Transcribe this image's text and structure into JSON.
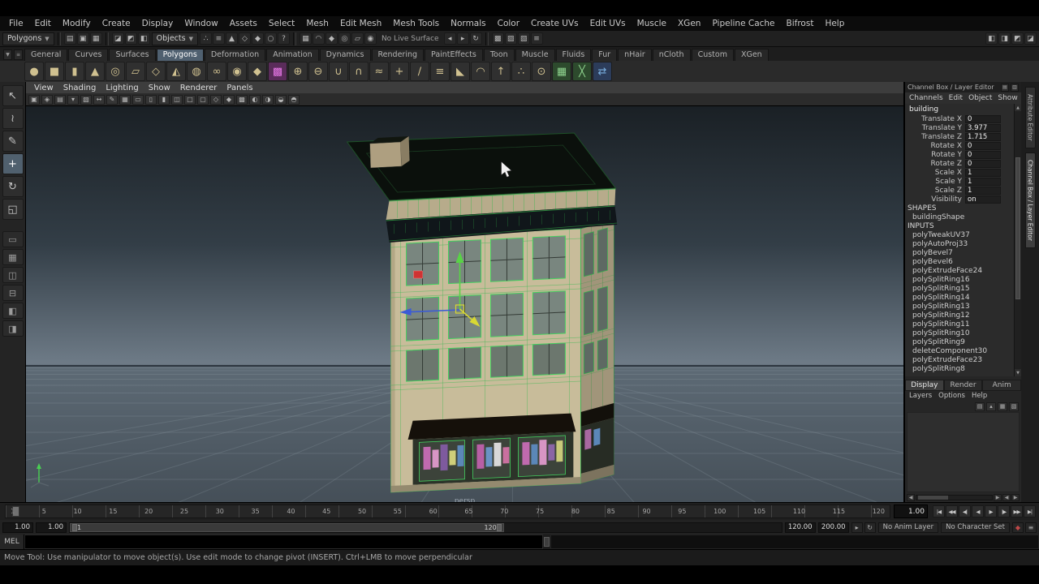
{
  "menu_bar": [
    "File",
    "Edit",
    "Modify",
    "Create",
    "Display",
    "Window",
    "Assets",
    "Select",
    "Mesh",
    "Edit Mesh",
    "Mesh Tools",
    "Normals",
    "Color",
    "Create UVs",
    "Edit UVs",
    "Muscle",
    "XGen",
    "Pipeline Cache",
    "Bifrost",
    "Help"
  ],
  "status_line": {
    "mode_menu": "Polygons",
    "objects_menu": "Objects",
    "no_live_surface": "No Live Surface",
    "file_icons": [
      {
        "name": "new-scene-icon",
        "glyph": "▤"
      },
      {
        "name": "open-scene-icon",
        "glyph": "▣"
      },
      {
        "name": "save-scene-icon",
        "glyph": "▦"
      }
    ],
    "selection_icons": [
      {
        "name": "select-hierarchy-icon",
        "glyph": "◪"
      },
      {
        "name": "select-object-icon",
        "glyph": "◩"
      },
      {
        "name": "select-component-icon",
        "glyph": "◧"
      }
    ],
    "mask_icons": [
      {
        "name": "mask-points-icon",
        "glyph": "∴"
      },
      {
        "name": "mask-lines-icon",
        "glyph": "≡"
      },
      {
        "name": "mask-faces-icon",
        "glyph": "▲"
      },
      {
        "name": "mask-hulls-icon",
        "glyph": "◇"
      },
      {
        "name": "mask-pivots-icon",
        "glyph": "◆"
      },
      {
        "name": "mask-handles-icon",
        "glyph": "○"
      },
      {
        "name": "mask-misc-icon",
        "glyph": "?"
      }
    ],
    "snap_icons": [
      {
        "name": "snap-grid-icon",
        "glyph": "▦"
      },
      {
        "name": "snap-curve-icon",
        "glyph": "◠"
      },
      {
        "name": "snap-point-icon",
        "glyph": "◆"
      },
      {
        "name": "snap-projected-center-icon",
        "glyph": "◎"
      },
      {
        "name": "snap-view-plane-icon",
        "glyph": "▱"
      },
      {
        "name": "make-live-icon",
        "glyph": "◉"
      }
    ],
    "history_icons": [
      {
        "name": "input-connections-icon",
        "glyph": "◂"
      },
      {
        "name": "output-connections-icon",
        "glyph": "▸"
      },
      {
        "name": "construction-history-icon",
        "glyph": "↻"
      }
    ],
    "render_icons": [
      {
        "name": "open-render-view-icon",
        "glyph": "▩"
      },
      {
        "name": "render-current-frame-icon",
        "glyph": "▨"
      },
      {
        "name": "ipr-render-icon",
        "glyph": "▧"
      },
      {
        "name": "render-settings-icon",
        "glyph": "≡"
      }
    ],
    "right_icons": [
      {
        "name": "toggle-modeling-toolkit-icon",
        "glyph": "◧"
      },
      {
        "name": "toggle-attribute-editor-icon",
        "glyph": "◨"
      },
      {
        "name": "toggle-tool-settings-icon",
        "glyph": "◩"
      },
      {
        "name": "toggle-channel-box-icon",
        "glyph": "◪"
      }
    ]
  },
  "shelf": {
    "tabs": [
      {
        "label": "General"
      },
      {
        "label": "Curves"
      },
      {
        "label": "Surfaces"
      },
      {
        "label": "Polygons",
        "active": true
      },
      {
        "label": "Deformation"
      },
      {
        "label": "Animation"
      },
      {
        "label": "Dynamics"
      },
      {
        "label": "Rendering"
      },
      {
        "label": "PaintEffects"
      },
      {
        "label": "Toon"
      },
      {
        "label": "Muscle"
      },
      {
        "label": "Fluids"
      },
      {
        "label": "Fur"
      },
      {
        "label": "nHair"
      },
      {
        "label": "nCloth"
      },
      {
        "label": "Custom"
      },
      {
        "label": "XGen"
      }
    ],
    "icons": [
      {
        "name": "polygon-sphere-icon",
        "glyph": "●"
      },
      {
        "name": "polygon-cube-icon",
        "glyph": "■"
      },
      {
        "name": "polygon-cylinder-icon",
        "glyph": "▮"
      },
      {
        "name": "polygon-cone-icon",
        "glyph": "▲"
      },
      {
        "name": "polygon-torus-icon",
        "glyph": "◎"
      },
      {
        "name": "polygon-plane-icon",
        "glyph": "▱"
      },
      {
        "name": "polygon-prism-icon",
        "glyph": "◇"
      },
      {
        "name": "polygon-pyramid-icon",
        "glyph": "◭"
      },
      {
        "name": "polygon-pipe-icon",
        "glyph": "◍"
      },
      {
        "name": "polygon-helix-icon",
        "glyph": "∞"
      },
      {
        "name": "polygon-soccer-ball-icon",
        "glyph": "◉"
      },
      {
        "name": "polygon-platonic-icon",
        "glyph": "◆"
      },
      {
        "name": "uv-editor-icon",
        "glyph": "▩",
        "color": "#e878e8",
        "bg": "#5a2c5a"
      },
      {
        "name": "combine-icon",
        "glyph": "⊕"
      },
      {
        "name": "separate-icon",
        "glyph": "⊖"
      },
      {
        "name": "boolean-union-icon",
        "glyph": "∪"
      },
      {
        "name": "boolean-intersect-icon",
        "glyph": "∩"
      },
      {
        "name": "smooth-icon",
        "glyph": "≈"
      },
      {
        "name": "append-to-polygon-icon",
        "glyph": "+"
      },
      {
        "name": "split-polygon-icon",
        "glyph": "∕"
      },
      {
        "name": "insert-edge-loop-icon",
        "glyph": "≡"
      },
      {
        "name": "bevel-icon",
        "glyph": "◣"
      },
      {
        "name": "bridge-icon",
        "glyph": "◠"
      },
      {
        "name": "extrude-icon",
        "glyph": "↑"
      },
      {
        "name": "merge-vertices-icon",
        "glyph": "∴"
      },
      {
        "name": "target-weld-icon",
        "glyph": "⊙"
      },
      {
        "name": "quad-draw-icon",
        "glyph": "▦",
        "color": "#8fd48f",
        "bg": "#2d4a2d"
      },
      {
        "name": "multi-cut-icon",
        "glyph": "╳",
        "color": "#8fd48f",
        "bg": "#2d4a2d"
      },
      {
        "name": "symmetry-icon",
        "glyph": "⇄",
        "color": "#7ab0e0",
        "bg": "#2c3c5a"
      }
    ]
  },
  "toolbox": {
    "tools": [
      {
        "name": "select-tool-icon",
        "glyph": "↖"
      },
      {
        "name": "lasso-tool-icon",
        "glyph": "≀"
      },
      {
        "name": "paint-select-tool-icon",
        "glyph": "✎"
      },
      {
        "name": "move-tool-icon",
        "glyph": "+",
        "active": true
      },
      {
        "name": "rotate-tool-icon",
        "glyph": "↻"
      },
      {
        "name": "scale-tool-icon",
        "glyph": "◱"
      }
    ],
    "layouts": [
      {
        "name": "layout-single-pane-icon",
        "glyph": "▭"
      },
      {
        "name": "layout-four-pane-icon",
        "glyph": "▦"
      },
      {
        "name": "layout-two-pane-side-icon",
        "glyph": "◫"
      },
      {
        "name": "layout-two-pane-stacked-icon",
        "glyph": "⊟"
      },
      {
        "name": "layout-outliner-persp-icon",
        "glyph": "◧"
      },
      {
        "name": "layout-persp-graph-icon",
        "glyph": "◨"
      }
    ]
  },
  "viewport": {
    "menus": [
      "View",
      "Shading",
      "Lighting",
      "Show",
      "Renderer",
      "Panels"
    ],
    "toolbar_icons": [
      {
        "name": "camera-select-icon",
        "glyph": "▣"
      },
      {
        "name": "camera-lock-icon",
        "glyph": "◈"
      },
      {
        "name": "camera-attributes-icon",
        "glyph": "▤"
      },
      {
        "name": "bookmarks-icon",
        "glyph": "▾"
      },
      {
        "name": "image-plane-icon",
        "glyph": "▧"
      },
      {
        "name": "2d-pan-zoom-icon",
        "glyph": "↔"
      },
      {
        "name": "grease-pencil-icon",
        "glyph": "✎"
      },
      {
        "name": "grid-toggle-icon",
        "glyph": "▦"
      },
      {
        "name": "film-gate-icon",
        "glyph": "▭"
      },
      {
        "name": "resolution-gate-icon",
        "glyph": "▯"
      },
      {
        "name": "gate-mask-icon",
        "glyph": "▮"
      },
      {
        "name": "field-chart-icon",
        "glyph": "◫"
      },
      {
        "name": "safe-action-icon",
        "glyph": "□"
      },
      {
        "name": "safe-title-icon",
        "glyph": "▢"
      },
      {
        "name": "wireframe-mode-icon",
        "glyph": "◇"
      },
      {
        "name": "shaded-mode-icon",
        "glyph": "◆"
      },
      {
        "name": "textured-mode-icon",
        "glyph": "▩"
      },
      {
        "name": "lighting-toggle-icon",
        "glyph": "◐"
      },
      {
        "name": "shadows-toggle-icon",
        "glyph": "◑"
      },
      {
        "name": "xray-toggle-icon",
        "glyph": "◒"
      },
      {
        "name": "isolate-select-icon",
        "glyph": "◓"
      }
    ],
    "camera_label": "persp"
  },
  "channel_box": {
    "title": "Channel Box / Layer Editor",
    "title_icons": [
      {
        "name": "channel-box-menu-icon",
        "glyph": "▤"
      },
      {
        "name": "layer-editor-menu-icon",
        "glyph": "▥"
      }
    ],
    "menus": [
      "Channels",
      "Edit",
      "Object",
      "Show"
    ],
    "object_name": "building",
    "channels": [
      {
        "name": "Translate X",
        "value": "0"
      },
      {
        "name": "Translate Y",
        "value": "3.977"
      },
      {
        "name": "Translate Z",
        "value": "1.715"
      },
      {
        "name": "Rotate X",
        "value": "0"
      },
      {
        "name": "Rotate Y",
        "value": "0"
      },
      {
        "name": "Rotate Z",
        "value": "0"
      },
      {
        "name": "Scale X",
        "value": "1"
      },
      {
        "name": "Scale Y",
        "value": "1"
      },
      {
        "name": "Scale Z",
        "value": "1"
      },
      {
        "name": "Visibility",
        "value": "on"
      }
    ],
    "shapes_header": "SHAPES",
    "shapes": [
      "buildingShape"
    ],
    "inputs_header": "INPUTS",
    "inputs": [
      "polyTweakUV37",
      "polyAutoProj33",
      "polyBevel7",
      "polyBevel6",
      "polyExtrudeFace24",
      "polySplitRing16",
      "polySplitRing15",
      "polySplitRing14",
      "polySplitRing13",
      "polySplitRing12",
      "polySplitRing11",
      "polySplitRing10",
      "polySplitRing9",
      "deleteComponent30",
      "polyExtrudeFace23",
      "polySplitRing8"
    ]
  },
  "layer_editor": {
    "tabs": [
      {
        "label": "Display",
        "active": true
      },
      {
        "label": "Render"
      },
      {
        "label": "Anim"
      }
    ],
    "menus": [
      "Layers",
      "Options",
      "Help"
    ],
    "icons": [
      {
        "name": "layer-options-icon",
        "glyph": "▤"
      },
      {
        "name": "move-layer-up-icon",
        "glyph": "▴"
      },
      {
        "name": "create-empty-layer-icon",
        "glyph": "▦"
      },
      {
        "name": "create-layer-from-selected-icon",
        "glyph": "▧"
      }
    ]
  },
  "side_tabs": [
    {
      "label": "Attribute Editor"
    },
    {
      "label": "Channel Box / Layer Editor",
      "active": true
    }
  ],
  "time_slider": {
    "ticks": [
      "1",
      "5",
      "10",
      "15",
      "20",
      "25",
      "30",
      "35",
      "40",
      "45",
      "50",
      "55",
      "60",
      "65",
      "70",
      "75",
      "80",
      "85",
      "90",
      "95",
      "100",
      "105",
      "110",
      "115",
      "120"
    ],
    "current_time": "1.00",
    "playback_buttons": [
      {
        "name": "go-to-start-button",
        "glyph": "|◀"
      },
      {
        "name": "step-back-frame-button",
        "glyph": "◀◀"
      },
      {
        "name": "step-back-key-button",
        "glyph": "◀|"
      },
      {
        "name": "play-backwards-button",
        "glyph": "◀"
      },
      {
        "name": "play-forwards-button",
        "glyph": "▶"
      },
      {
        "name": "step-forward-key-button",
        "glyph": "|▶"
      },
      {
        "name": "step-forward-frame-button",
        "glyph": "▶▶"
      },
      {
        "name": "go-to-end-button",
        "glyph": "▶|"
      }
    ]
  },
  "range_slider": {
    "anim_start": "1.00",
    "playback_start": "1.00",
    "bar_start": "1",
    "bar_end": "120",
    "playback_end": "120.00",
    "anim_end": "200.00",
    "mid_icons": [
      {
        "name": "playback-speed-icon",
        "glyph": "▸"
      },
      {
        "name": "loop-mode-icon",
        "glyph": "↻"
      }
    ],
    "anim_layer_menu": "No Anim Layer",
    "character_set_menu": "No Character Set",
    "right_icons": [
      {
        "name": "auto-keyframe-icon",
        "glyph": "◆",
        "color": "#c04848"
      },
      {
        "name": "animation-preferences-icon",
        "glyph": "≡"
      }
    ]
  },
  "command_line": {
    "label": "MEL"
  },
  "help_line": {
    "text": "Move Tool: Use manipulator to move object(s). Use edit mode to change pivot (INSERT).  Ctrl+LMB to move perpendicular"
  }
}
